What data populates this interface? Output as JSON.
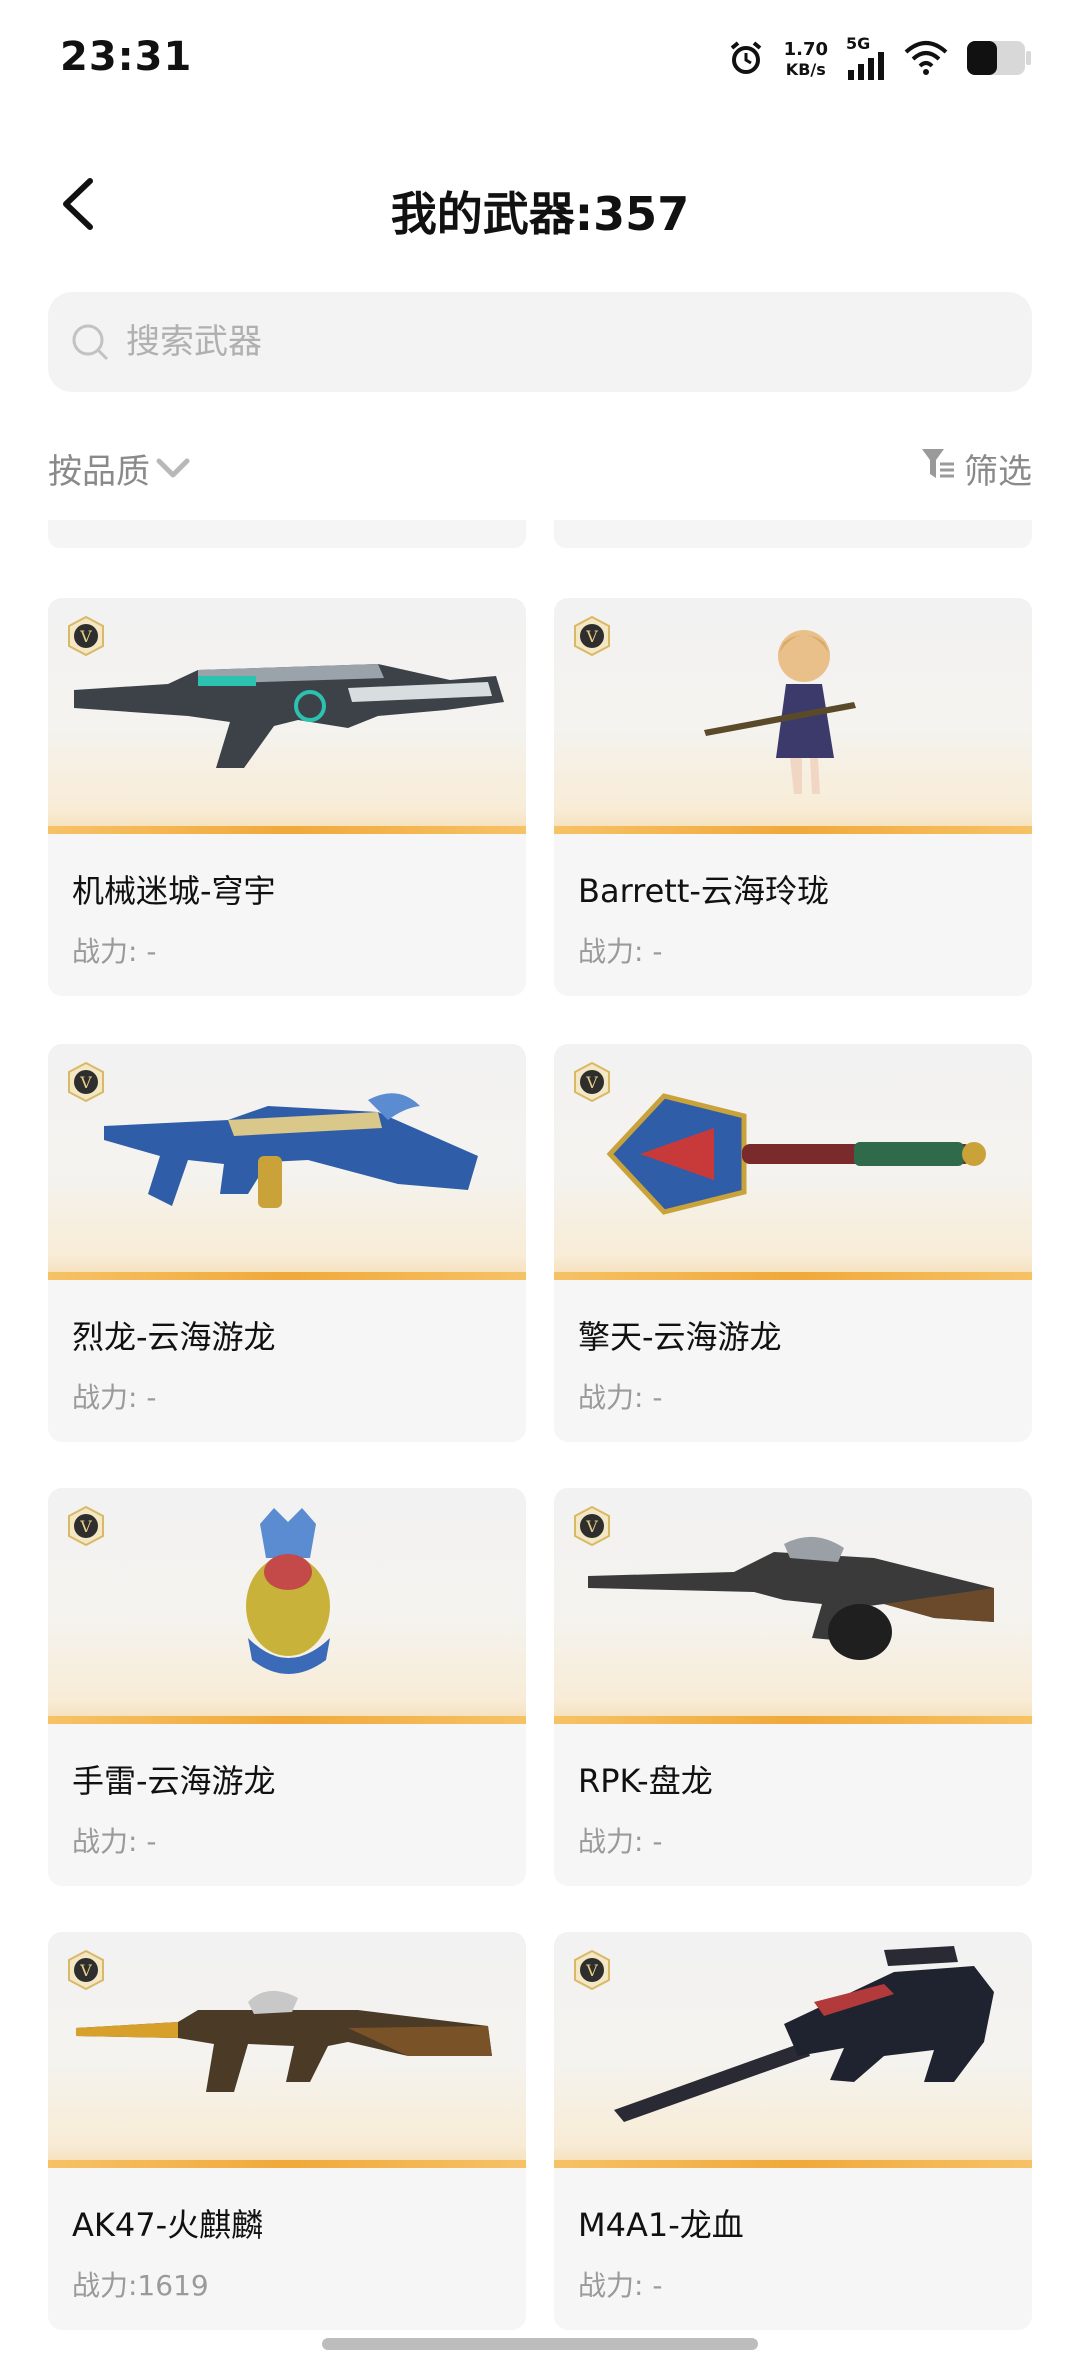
{
  "status_bar": {
    "time": "23:31",
    "net_speed_value": "1.70",
    "net_speed_unit": "KB/s",
    "network_type": "5G",
    "icons": [
      "alarm-icon",
      "signal-icon",
      "wifi-icon",
      "battery-icon"
    ]
  },
  "header": {
    "back_icon": "chevron-left-icon",
    "title": "我的武器:357"
  },
  "search": {
    "placeholder": "搜索武器",
    "value": ""
  },
  "toolbar": {
    "sort_label": "按品质",
    "filter_label": "筛选"
  },
  "weapons": [
    {
      "name": "机械迷城-穹宇",
      "power": "战力: -"
    },
    {
      "name": "Barrett-云海玲珑",
      "power": "战力: -"
    },
    {
      "name": "烈龙-云海游龙",
      "power": "战力: -"
    },
    {
      "name": "擎天-云海游龙",
      "power": "战力: -"
    },
    {
      "name": "手雷-云海游龙",
      "power": "战力: -"
    },
    {
      "name": "RPK-盘龙",
      "power": "战力: -"
    },
    {
      "name": "AK47-火麒麟",
      "power": "战力:1619"
    },
    {
      "name": "M4A1-龙血",
      "power": "战力: -"
    }
  ],
  "badge_label": "V",
  "colors": {
    "card_bg": "#f6f6f6",
    "accent_orange": "#f0a93a",
    "muted_text": "#9a9a9a"
  }
}
